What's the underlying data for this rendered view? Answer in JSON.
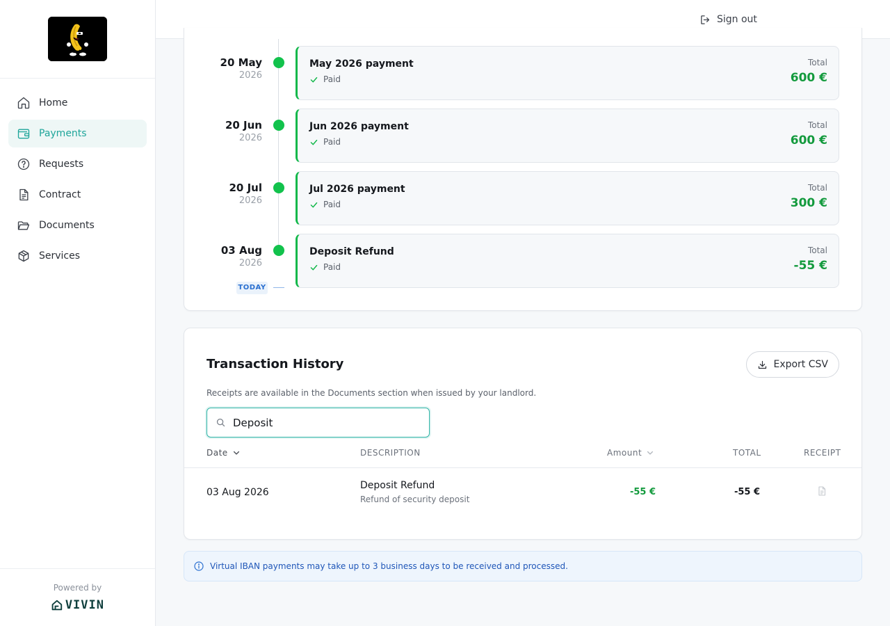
{
  "brand": {
    "logo_icon": "banana-mascot-logo",
    "powered_by": "Powered by",
    "vendor_name": "VIVIN",
    "accent_color": "#1ea59a"
  },
  "sidebar": {
    "items": [
      {
        "label": "Home",
        "icon": "home-icon",
        "active": false
      },
      {
        "label": "Payments",
        "icon": "wallet-icon",
        "active": true
      },
      {
        "label": "Requests",
        "icon": "question-circle-icon",
        "active": false
      },
      {
        "label": "Contract",
        "icon": "document-text-icon",
        "active": false
      },
      {
        "label": "Documents",
        "icon": "folder-open-icon",
        "active": false
      },
      {
        "label": "Services",
        "icon": "cube-icon",
        "active": false
      }
    ]
  },
  "header": {
    "sign_out": "Sign out"
  },
  "timeline": {
    "total_label": "Total",
    "today_label": "TODAY",
    "entries": [
      {
        "day": "20 May",
        "year": "2026",
        "title": "May 2026 payment",
        "status": "Paid",
        "total": "600 €"
      },
      {
        "day": "20 Jun",
        "year": "2026",
        "title": "Jun 2026 payment",
        "status": "Paid",
        "total": "600 €"
      },
      {
        "day": "20 Jul",
        "year": "2026",
        "title": "Jul 2026 payment",
        "status": "Paid",
        "total": "300 €"
      },
      {
        "day": "03 Aug",
        "year": "2026",
        "title": "Deposit Refund",
        "status": "Paid",
        "total": "-55 €"
      }
    ],
    "status_color": "#12b84a"
  },
  "transactions": {
    "title": "Transaction History",
    "export_label": "Export CSV",
    "subtitle": "Receipts are available in the Documents section when issued by your landlord.",
    "search_value": "Deposit",
    "columns": {
      "date": "Date",
      "description": "DESCRIPTION",
      "amount": "Amount",
      "total": "TOTAL",
      "receipt": "RECEIPT"
    },
    "rows": [
      {
        "date": "03 Aug 2026",
        "description": "Deposit Refund",
        "detail": "Refund of security deposit",
        "amount": "-55 €",
        "total": "-55 €",
        "receipt_icon": "document-icon"
      }
    ]
  },
  "info_banner": {
    "text": "Virtual IBAN payments may take up to 3 business days to be received and processed."
  }
}
